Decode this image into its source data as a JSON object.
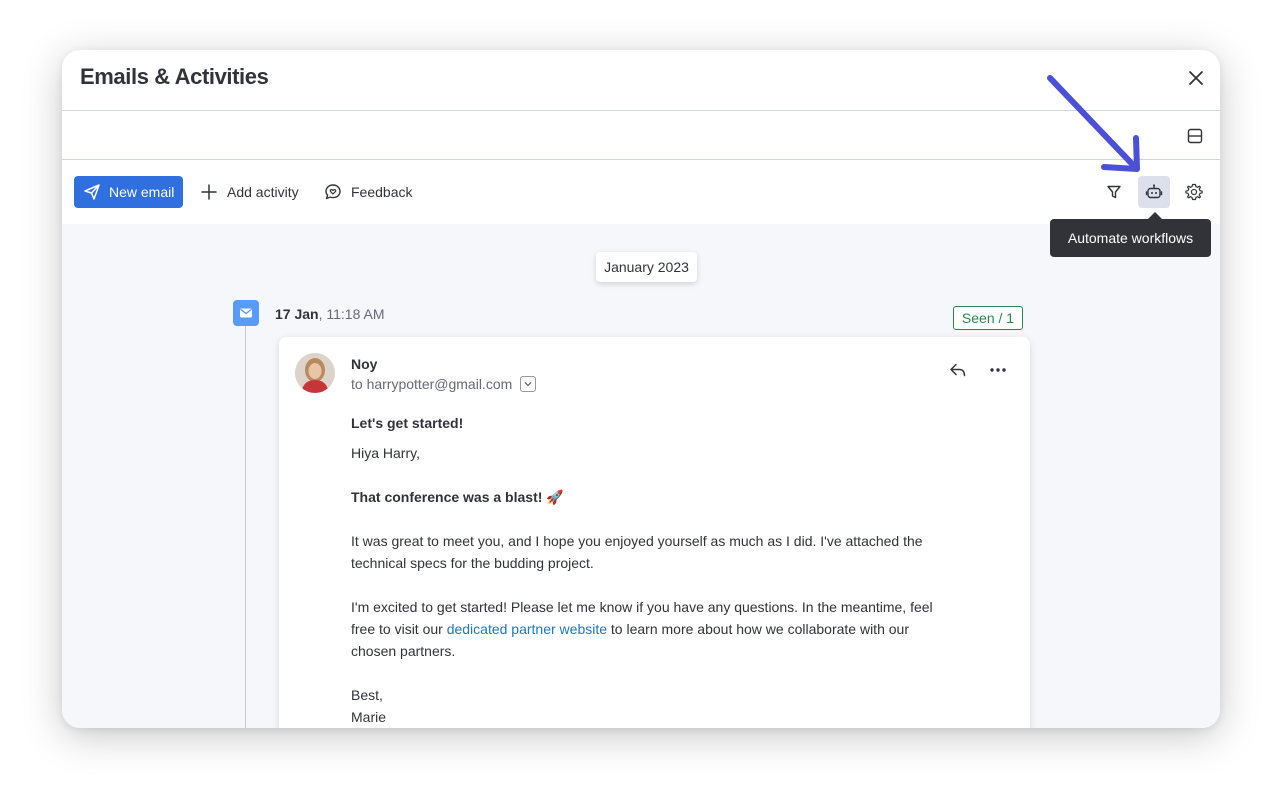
{
  "window": {
    "title": "Emails & Activities"
  },
  "toolbar": {
    "new_email_label": "New email",
    "add_activity_label": "Add activity",
    "feedback_label": "Feedback",
    "tooltip_text": "Automate workflows"
  },
  "timeline": {
    "month_label": "January 2023",
    "date_bold": "17 Jan",
    "time": ", 11:18 AM",
    "seen_label": "Seen / 1"
  },
  "email": {
    "sender": "Noy",
    "recipient": "to harrypotter@gmail.com",
    "subject": "Let's get started!",
    "greeting": "Hiya Harry,",
    "highlight": "That conference was a blast! 🚀",
    "paragraph1": "It was great to meet you, and I hope you enjoyed yourself as much as I did. I've attached the technical specs for the budding project.",
    "paragraph2_start": "I'm excited to get started! Please let me know if you have any questions. In the meantime, feel free to visit our ",
    "link_text": "dedicated partner website",
    "paragraph2_end": " to learn more about how we collaborate with our chosen partners.",
    "signoff": "Best,",
    "signature": "Marie"
  },
  "colors": {
    "primary": "#2f6fe0",
    "seen_green": "#258750",
    "link": "#1f76c2",
    "annotation_arrow": "#4c4fd8"
  },
  "icons": [
    "close-icon",
    "layout-icon",
    "send-icon",
    "plus-icon",
    "feedback-icon",
    "filter-icon",
    "robot-icon",
    "gear-icon",
    "mail-icon",
    "chevron-down-icon",
    "reply-icon",
    "more-icon"
  ]
}
